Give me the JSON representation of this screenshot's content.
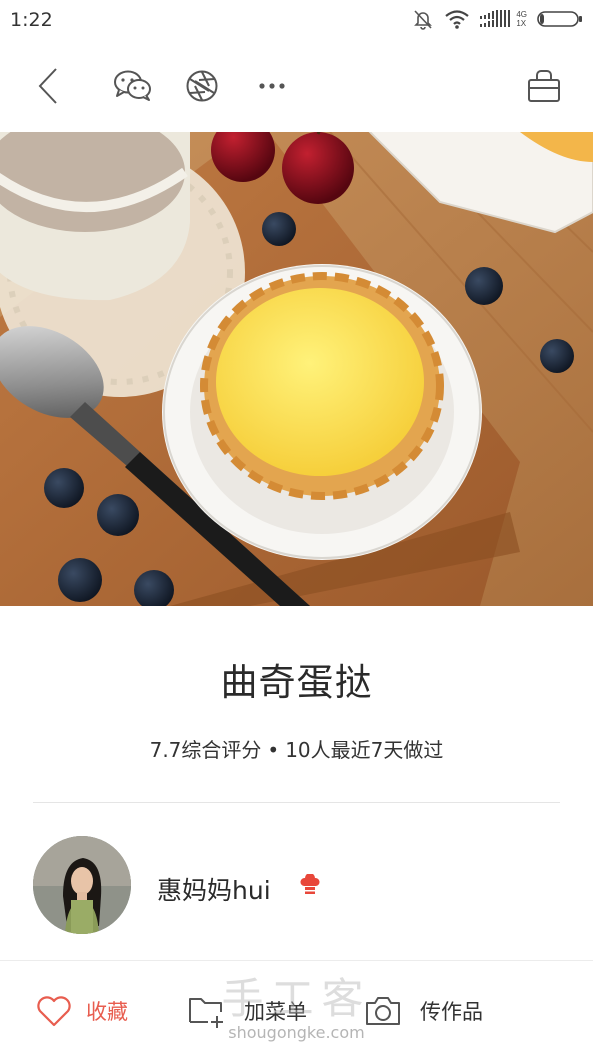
{
  "status_bar": {
    "time": "1:22",
    "network_top": "4G",
    "network_bottom": "1X"
  },
  "toolbar": {
    "back": "chevron-left-icon",
    "wechat": "wechat-icon",
    "moments": "moments-icon",
    "more": "more-icon",
    "basket": "shopping-basket-icon"
  },
  "recipe": {
    "title": "曲奇蛋挞",
    "rating_text": "7.7综合评分",
    "separator": "•",
    "recent_text": "10人最近7天做过"
  },
  "author": {
    "name": "惠妈妈hui",
    "badge_icon": "chef-hat-icon"
  },
  "bottom_bar": {
    "favorite_label": "收藏",
    "add_menu_label": "加菜单",
    "upload_label": "传作品"
  },
  "watermark": {
    "text": "手工客",
    "url": "shougongke.com"
  },
  "colors": {
    "accent": "#e85d4f",
    "text": "#333333",
    "divider": "#e5e5e5"
  }
}
